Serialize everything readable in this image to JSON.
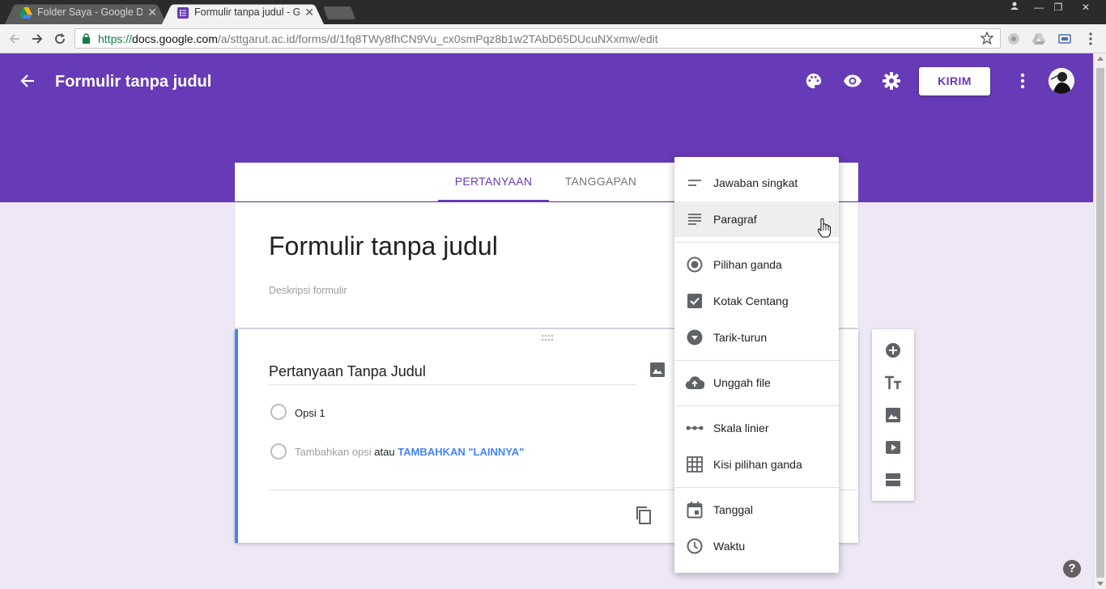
{
  "browser": {
    "tabs": [
      {
        "title": "Folder Saya - Google Dri",
        "favicon": "google-drive-icon",
        "active": false
      },
      {
        "title": "Formulir tanpa judul - Go",
        "favicon": "google-forms-icon",
        "active": true
      }
    ],
    "url_scheme": "https://",
    "url_host": "docs.google.com",
    "url_path": "/a/sttgarut.ac.id/forms/d/1fq8TWy8fhCN9Vu_cx0smPqz8b1w2TAbD65DUcuNXxmw/edit"
  },
  "header": {
    "title": "Formulir tanpa judul",
    "send_label": "KIRIM",
    "icons": [
      "palette-icon",
      "eye-icon",
      "settings-icon",
      "more-vert-icon"
    ]
  },
  "form": {
    "tabs": [
      {
        "label": "PERTANYAAN",
        "active": true
      },
      {
        "label": "TANGGAPAN",
        "active": false
      }
    ],
    "title": "Formulir tanpa judul",
    "description_placeholder": "Deskripsi formulir",
    "question": {
      "title": "Pertanyaan Tanpa Judul",
      "options": [
        "Opsi 1"
      ],
      "add_option": "Tambahkan opsi",
      "or": "atau",
      "add_other": "TAMBAHKAN \"LAINNYA\""
    }
  },
  "menu": {
    "items": [
      {
        "label": "Jawaban singkat",
        "icon": "short-text-icon"
      },
      {
        "label": "Paragraf",
        "icon": "paragraph-icon",
        "hover": true
      },
      {
        "label": "Pilihan ganda",
        "icon": "radio-button-icon"
      },
      {
        "label": "Kotak Centang",
        "icon": "checkbox-icon"
      },
      {
        "label": "Tarik-turun",
        "icon": "dropdown-icon"
      },
      {
        "label": "Unggah file",
        "icon": "cloud-upload-icon"
      },
      {
        "label": "Skala linier",
        "icon": "linear-scale-icon"
      },
      {
        "label": "Kisi pilihan ganda",
        "icon": "grid-icon"
      },
      {
        "label": "Tanggal",
        "icon": "calendar-icon"
      },
      {
        "label": "Waktu",
        "icon": "clock-icon"
      }
    ]
  },
  "sidebar": {
    "icons": [
      "add-question-icon",
      "add-title-icon",
      "add-image-icon",
      "add-video-icon",
      "add-section-icon"
    ]
  },
  "colors": {
    "brand": "#673ab7",
    "accent": "#4285f4",
    "background": "#ede7f6"
  }
}
